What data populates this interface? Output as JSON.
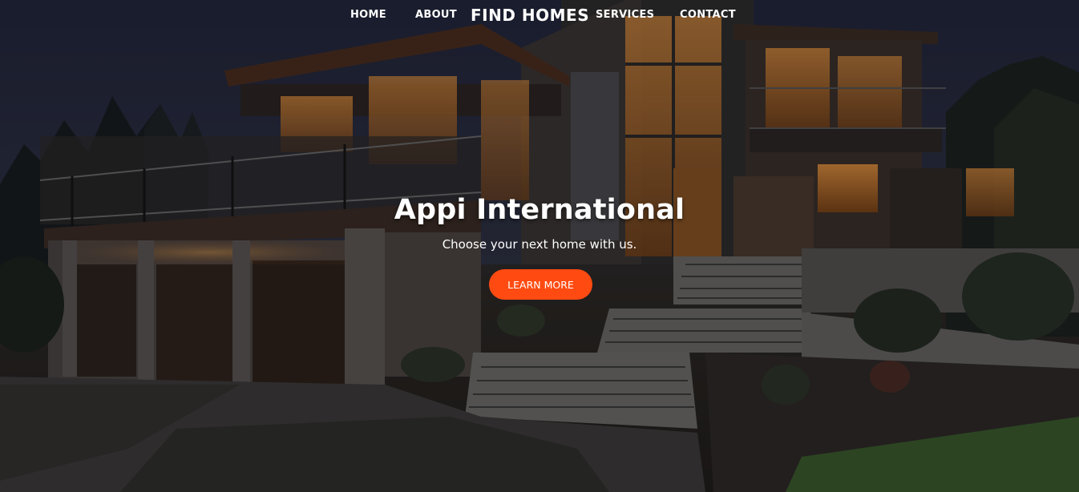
{
  "nav": {
    "home": "HOME",
    "about": "ABOUT",
    "brand": "FIND HOMES",
    "services": "SERVICES",
    "contact": "CONTACT"
  },
  "hero": {
    "title": "Appi International",
    "subtitle": "Choose your next home with us.",
    "cta_label": "LEARN MORE"
  },
  "colors": {
    "accent": "#ff4b12",
    "text": "#ffffff"
  }
}
